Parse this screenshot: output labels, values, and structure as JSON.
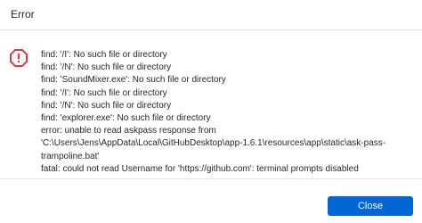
{
  "dialog": {
    "title": "Error",
    "icon": "error-icon",
    "accent_color": "#d73a49",
    "message_lines": [
      "find: '/I': No such file or directory",
      "find: '/N': No such file or directory",
      "find: 'SoundMixer.exe': No such file or directory",
      "find: '/I': No such file or directory",
      "find: '/N': No such file or directory",
      "find: 'explorer.exe': No such file or directory",
      "error: unable to read askpass response from 'C:\\Users\\Jens\\AppData\\Local\\GitHubDesktop\\app-1.6.1\\resources\\app\\static\\ask-pass-trampoline.bat'",
      "fatal: could not read Username for 'https://github.com': terminal prompts disabled"
    ],
    "close_label": "Close",
    "button_color": "#0366d6"
  }
}
